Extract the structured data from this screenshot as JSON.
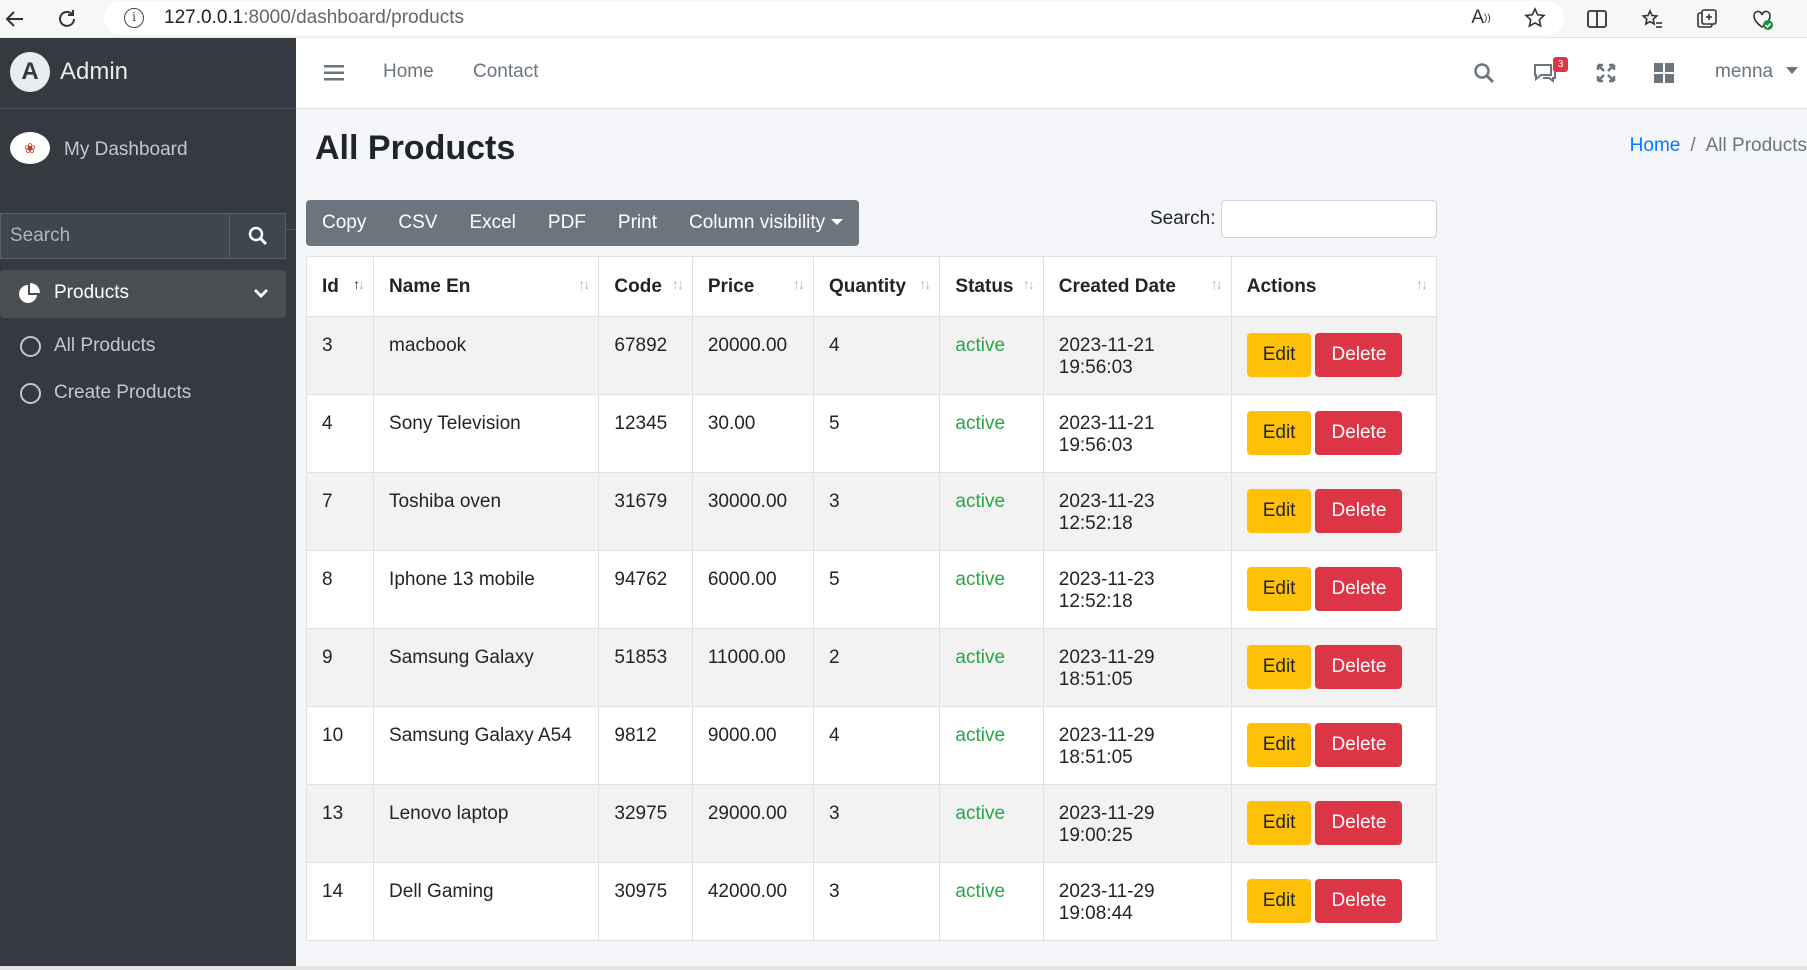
{
  "browser": {
    "url_host": "127.0.0.1",
    "url_rest": ":8000/dashboard/products"
  },
  "sidebar": {
    "brand": "Admin",
    "user_name": "My Dashboard",
    "search_placeholder": "Search",
    "menu": {
      "products_label": "Products",
      "items": [
        {
          "label": "All Products"
        },
        {
          "label": "Create Products"
        }
      ]
    }
  },
  "topnav": {
    "links": [
      "Home",
      "Contact"
    ],
    "notification_count": "3",
    "user": "menna"
  },
  "page": {
    "title": "All Products",
    "breadcrumb": {
      "home": "Home",
      "current": "All Products"
    }
  },
  "toolbar": {
    "buttons": [
      "Copy",
      "CSV",
      "Excel",
      "PDF",
      "Print"
    ],
    "column_visibility": "Column visibility",
    "search_label": "Search:"
  },
  "table": {
    "columns": [
      "Id",
      "Name En",
      "Code",
      "Price",
      "Quantity",
      "Status",
      "Created Date",
      "Actions"
    ],
    "edit_label": "Edit",
    "delete_label": "Delete",
    "rows": [
      {
        "id": "3",
        "name": "macbook",
        "code": "67892",
        "price": "20000.00",
        "quantity": "4",
        "status": "active",
        "created": "2023-11-21 19:56:03"
      },
      {
        "id": "4",
        "name": "Sony Television",
        "code": "12345",
        "price": "30.00",
        "quantity": "5",
        "status": "active",
        "created": "2023-11-21 19:56:03"
      },
      {
        "id": "7",
        "name": "Toshiba oven",
        "code": "31679",
        "price": "30000.00",
        "quantity": "3",
        "status": "active",
        "created": "2023-11-23 12:52:18"
      },
      {
        "id": "8",
        "name": "Iphone 13 mobile",
        "code": "94762",
        "price": "6000.00",
        "quantity": "5",
        "status": "active",
        "created": "2023-11-23 12:52:18"
      },
      {
        "id": "9",
        "name": "Samsung Galaxy",
        "code": "51853",
        "price": "11000.00",
        "quantity": "2",
        "status": "active",
        "created": "2023-11-29 18:51:05"
      },
      {
        "id": "10",
        "name": "Samsung Galaxy A54",
        "code": "9812",
        "price": "9000.00",
        "quantity": "4",
        "status": "active",
        "created": "2023-11-29 18:51:05"
      },
      {
        "id": "13",
        "name": "Lenovo laptop",
        "code": "32975",
        "price": "29000.00",
        "quantity": "3",
        "status": "active",
        "created": "2023-11-29 19:00:25"
      },
      {
        "id": "14",
        "name": "Dell Gaming",
        "code": "30975",
        "price": "42000.00",
        "quantity": "3",
        "status": "active",
        "created": "2023-11-29 19:08:44"
      }
    ]
  },
  "colors": {
    "sidebar_bg": "#343a40",
    "edit_button": "#ffc107",
    "delete_button": "#dc3545",
    "status_active": "#28a745",
    "link": "#007bff"
  }
}
